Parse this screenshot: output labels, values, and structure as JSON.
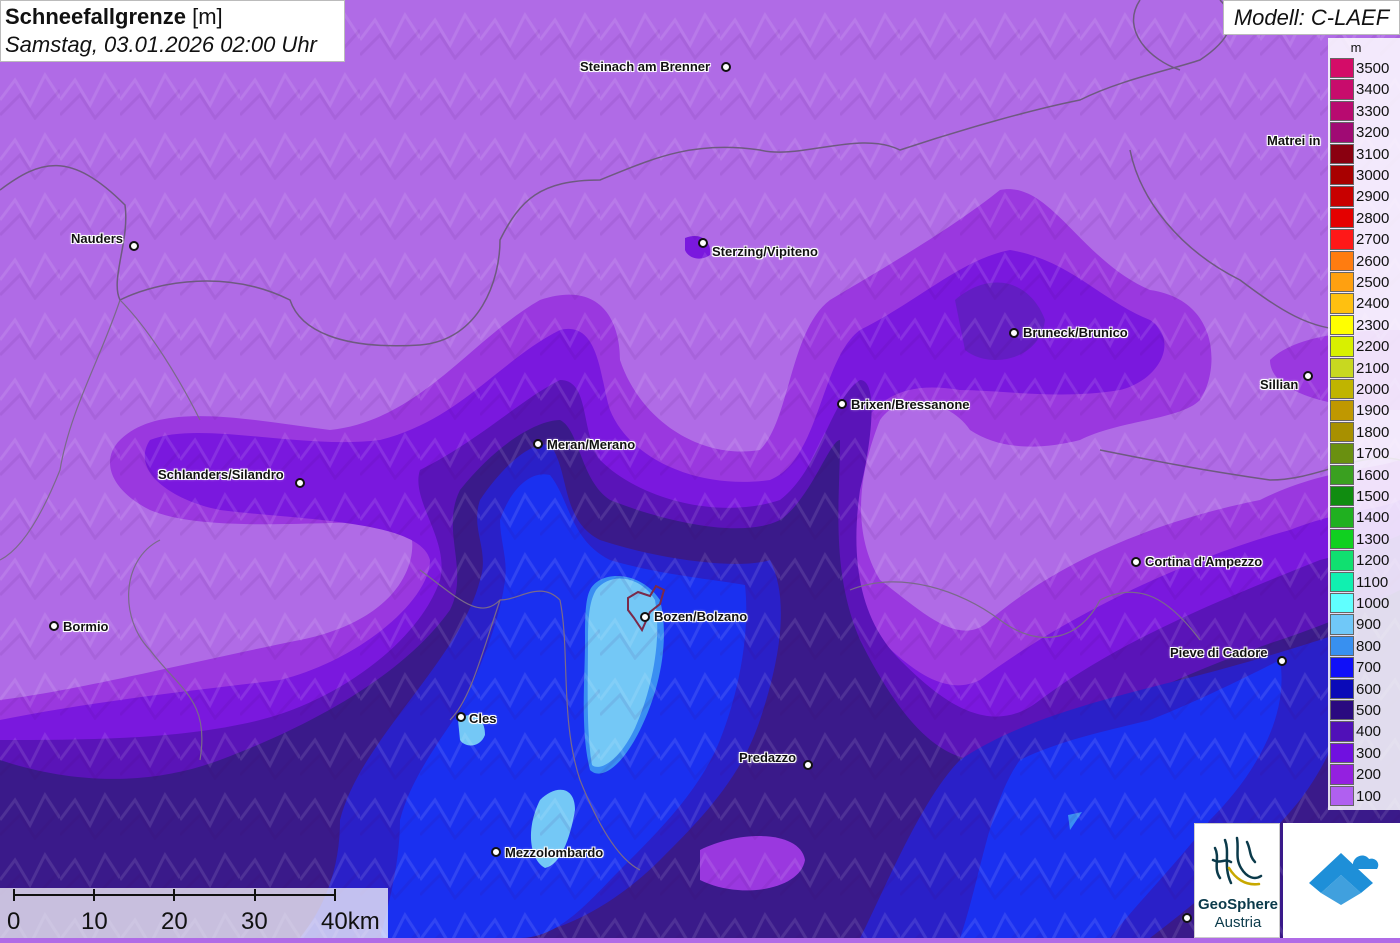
{
  "header": {
    "title_bold": "Schneefallgrenze",
    "title_unit": "[m]",
    "datetime": "Samstag, 03.01.2026 02:00 Uhr"
  },
  "model": {
    "label": "Modell: C-LAEF"
  },
  "legend": {
    "unit": "m",
    "items": [
      {
        "value": "3500",
        "color": "#d40c68"
      },
      {
        "value": "3400",
        "color": "#c80c6c"
      },
      {
        "value": "3300",
        "color": "#b80a70"
      },
      {
        "value": "3200",
        "color": "#a00a74"
      },
      {
        "value": "3100",
        "color": "#8a0010"
      },
      {
        "value": "3000",
        "color": "#a80000"
      },
      {
        "value": "2900",
        "color": "#c80000"
      },
      {
        "value": "2800",
        "color": "#e40000"
      },
      {
        "value": "2700",
        "color": "#ff1818"
      },
      {
        "value": "2600",
        "color": "#ff7c10"
      },
      {
        "value": "2500",
        "color": "#ffa010"
      },
      {
        "value": "2400",
        "color": "#ffc010"
      },
      {
        "value": "2300",
        "color": "#ffff00"
      },
      {
        "value": "2200",
        "color": "#d8f000"
      },
      {
        "value": "2100",
        "color": "#c8d820"
      },
      {
        "value": "2000",
        "color": "#c0b400"
      },
      {
        "value": "1900",
        "color": "#c09800"
      },
      {
        "value": "1800",
        "color": "#a89000"
      },
      {
        "value": "1700",
        "color": "#6a9010"
      },
      {
        "value": "1600",
        "color": "#3aa020"
      },
      {
        "value": "1500",
        "color": "#108c10"
      },
      {
        "value": "1400",
        "color": "#20b020"
      },
      {
        "value": "1300",
        "color": "#10d020"
      },
      {
        "value": "1200",
        "color": "#10e070"
      },
      {
        "value": "1100",
        "color": "#10f0b0"
      },
      {
        "value": "1000",
        "color": "#60ffff"
      },
      {
        "value": "900",
        "color": "#70c8f8"
      },
      {
        "value": "800",
        "color": "#3890f0"
      },
      {
        "value": "700",
        "color": "#1010f8"
      },
      {
        "value": "600",
        "color": "#0a0ab8"
      },
      {
        "value": "500",
        "color": "#2a0a80"
      },
      {
        "value": "400",
        "color": "#5010b8"
      },
      {
        "value": "300",
        "color": "#7010e0"
      },
      {
        "value": "200",
        "color": "#9420e0"
      },
      {
        "value": "100",
        "color": "#b060f0"
      }
    ]
  },
  "cities": [
    {
      "name": "Steinach am Brenner"
    },
    {
      "name": "Nauders"
    },
    {
      "name": "Sterzing/Vipiteno"
    },
    {
      "name": "Matrei in"
    },
    {
      "name": "Bruneck/Brunico"
    },
    {
      "name": "Sillian"
    },
    {
      "name": "Brixen/Bressanone"
    },
    {
      "name": "Meran/Merano"
    },
    {
      "name": "Schlanders/Silandro"
    },
    {
      "name": "Cortina d'Ampezzo"
    },
    {
      "name": "Bormio"
    },
    {
      "name": "Bozen/Bolzano"
    },
    {
      "name": "Pieve di Cadore"
    },
    {
      "name": "Cles"
    },
    {
      "name": "Predazzo"
    },
    {
      "name": "Mezzolombardo"
    }
  ],
  "scalebar": {
    "labels": [
      "0",
      "10",
      "20",
      "30",
      "40km"
    ]
  },
  "logos": {
    "geosphere_name": "GeoSphere",
    "geosphere_sub": "Austria"
  }
}
